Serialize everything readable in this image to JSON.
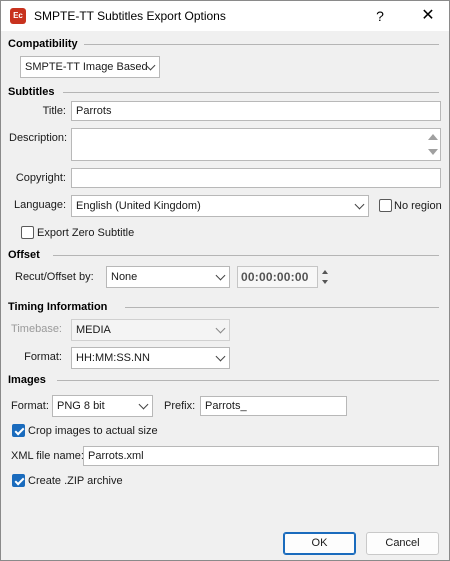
{
  "window": {
    "title": "SMPTE-TT Subtitles Export Options",
    "icon_text": "Ec",
    "help_glyph": "?",
    "close_glyph": "✕"
  },
  "compatibility": {
    "section_label": "Compatibility",
    "value": "SMPTE-TT Image Based"
  },
  "subtitles": {
    "section_label": "Subtitles",
    "title_label": "Title:",
    "title_value": "Parrots",
    "description_label": "Description:",
    "description_value": "",
    "copyright_label": "Copyright:",
    "copyright_value": "",
    "language_label": "Language:",
    "language_value": "English (United Kingdom)",
    "no_region_label": "No region",
    "no_region_checked": false,
    "export_zero_label": "Export Zero Subtitle",
    "export_zero_checked": false
  },
  "offset": {
    "section_label": "Offset",
    "recut_label": "Recut/Offset by:",
    "recut_value": "None",
    "timecode": "00:00:00:00"
  },
  "timing": {
    "section_label": "Timing Information",
    "timebase_label": "Timebase:",
    "timebase_value": "MEDIA",
    "format_label": "Format:",
    "format_value": "HH:MM:SS.NN"
  },
  "images": {
    "section_label": "Images",
    "format_label": "Format:",
    "format_value": "PNG 8 bit",
    "prefix_label": "Prefix:",
    "prefix_value": "Parrots_",
    "crop_label": "Crop images to actual size",
    "crop_checked": true,
    "xml_label": "XML file name:",
    "xml_value": "Parrots.xml",
    "zip_label": "Create .ZIP archive",
    "zip_checked": true
  },
  "buttons": {
    "ok": "OK",
    "cancel": "Cancel"
  },
  "colors": {
    "accent": "#1a6bbd",
    "app_icon": "#c8321e"
  }
}
